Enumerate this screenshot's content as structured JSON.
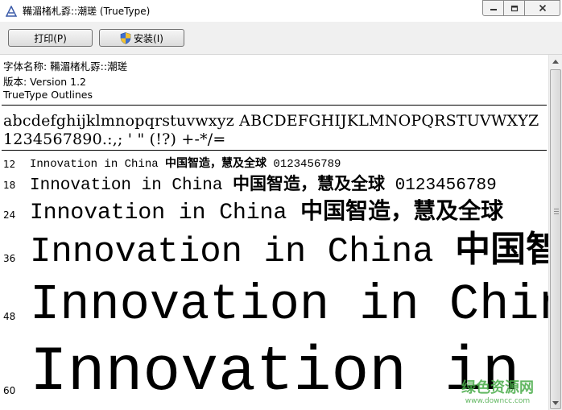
{
  "window": {
    "title": "鞴湄楮札孬::潮瑳 (TrueType)",
    "icon": "font-viewer-icon",
    "controls": {
      "minimize_icon": "minimize-icon",
      "maximize_icon": "maximize-icon",
      "close_icon": "close-icon"
    }
  },
  "toolbar": {
    "print_label": "打印(P)",
    "install_label": "安装(I)",
    "install_icon": "uac-shield-icon"
  },
  "font_info": {
    "name_line": "字体名称: 鞴湄楮札孬::潮瑳",
    "version_line": "版本: Version 1.2",
    "outline_line": "TrueType Outlines"
  },
  "charset": {
    "line1": "abcdefghijklmnopqrstuvwxyz ABCDEFGHIJKLMNOPQRSTUVWXYZ",
    "line2": "1234567890.:,; ' \" (!?) +-*/="
  },
  "samples": [
    {
      "size": "12",
      "latin": "Innovation in China ",
      "cjk": "中国智造，慧及全球",
      "digits": " 0123456789"
    },
    {
      "size": "18",
      "latin": "Innovation in China ",
      "cjk": "中国智造，慧及全球",
      "digits": " 0123456789"
    },
    {
      "size": "24",
      "latin": "Innovation in China ",
      "cjk": "中国智造，慧及全球",
      "digits": ""
    },
    {
      "size": "36",
      "latin": "Innovation in China ",
      "cjk": "中国智",
      "digits": ""
    },
    {
      "size": "48",
      "latin": "Innovation in China",
      "cjk": "",
      "digits": ""
    },
    {
      "size": "60",
      "latin": "Innovation in C",
      "cjk": "",
      "digits": ""
    }
  ],
  "watermark": {
    "main": "绿色资源网",
    "url": "www.downcc.com"
  },
  "colors": {
    "toolbar_bg": "#f0f0f0",
    "watermark": "#46aa46"
  }
}
